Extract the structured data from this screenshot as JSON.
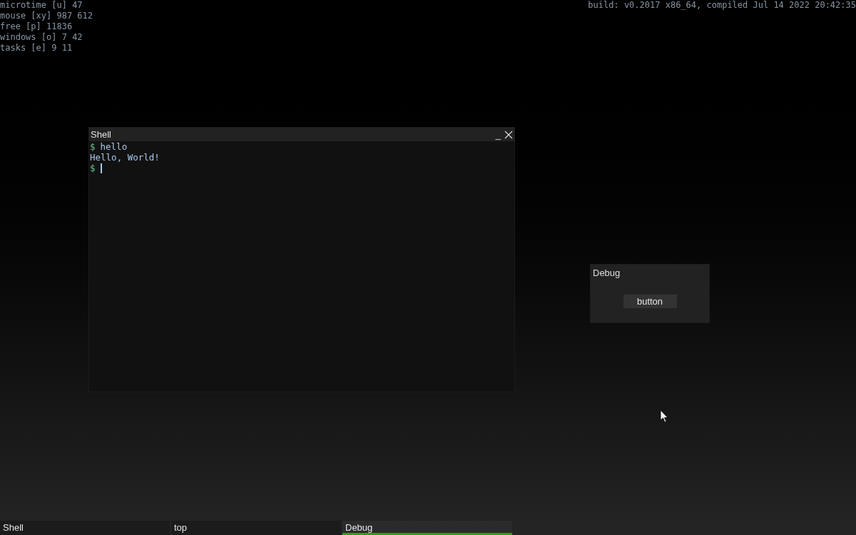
{
  "stats": [
    "microtime [u] 47",
    "mouse [xy] 987 612",
    "free [p] 11836",
    "windows [o] 7 42",
    "tasks [e] 9 11"
  ],
  "build": "build: v0.2017 x86_64, compiled Jul 14 2022 20:42:35",
  "shell_window": {
    "title": "Shell",
    "minimize": "_",
    "lines": [
      {
        "kind": "command",
        "prompt": "$",
        "text": "hello"
      },
      {
        "kind": "output",
        "text": "Hello, World!"
      },
      {
        "kind": "input",
        "prompt": "$"
      }
    ]
  },
  "debug_window": {
    "title": "Debug",
    "button": "button"
  },
  "taskbar": [
    {
      "label": "Shell",
      "selected": false
    },
    {
      "label": "top",
      "selected": false
    },
    {
      "label": "Debug",
      "selected": true
    }
  ]
}
